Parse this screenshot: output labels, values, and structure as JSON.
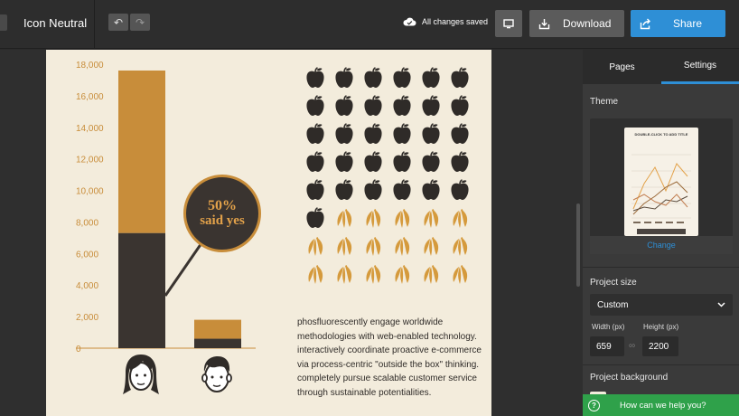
{
  "header": {
    "project_name": "Icon Neutral",
    "undo_glyph": "↶",
    "redo_glyph": "↷",
    "save_status": "All changes saved",
    "download_label": "Download",
    "share_label": "Share"
  },
  "chart_data": {
    "type": "bar",
    "categories": [
      "woman",
      "man"
    ],
    "series": [
      {
        "values": [
          7300,
          600
        ]
      },
      {
        "values": [
          10300,
          1200
        ]
      }
    ],
    "y_ticks": [
      "18,000",
      "16,000",
      "14,000",
      "12,000",
      "10,000",
      "8,000",
      "6,000",
      "4,000",
      "2,000",
      "0"
    ],
    "ylim": [
      0,
      18000
    ],
    "colors": {
      "dark": "#3a3430",
      "gold": "#c88d3a"
    },
    "callout_pct": "50%",
    "callout_text": "said yes"
  },
  "pictogram": {
    "columns": 6,
    "rows": 8,
    "apples": 31,
    "bananas": 17,
    "apple_color": "#2f2b28",
    "banana_color": "#d59a3c"
  },
  "body_text": "phosfluorescently engage worldwide methodologies with web-enabled technology. interactively coordinate proactive e-commerce via process-centric \"outside the box\" thinking. completely pursue scalable customer service through sustainable potentialities.",
  "panel": {
    "tab_pages": "Pages",
    "tab_settings": "Settings",
    "theme_title": "Theme",
    "theme_thumb_title": "DOUBLE-CLICK TO ADD TITLE",
    "change_label": "Change",
    "project_size_title": "Project size",
    "size_selected": "Custom",
    "width_label": "Width (px)",
    "height_label": "Height (px)",
    "width_value": "659",
    "height_value": "2200",
    "background_title": "Project background"
  },
  "help": {
    "label": "How can we help you?",
    "glyph": "?"
  },
  "colors": {
    "accent": "#2e8fd6",
    "help_green": "#2fa14a"
  }
}
